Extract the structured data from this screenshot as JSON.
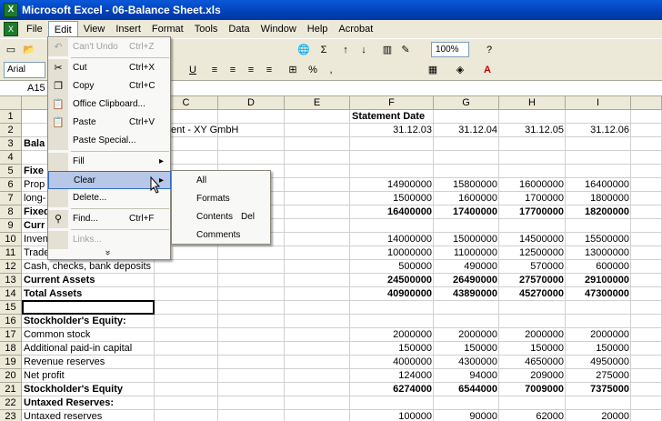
{
  "window": {
    "title": "Microsoft Excel - 06-Balance Sheet.xls",
    "app_icon": "X"
  },
  "menubar": {
    "items": [
      "File",
      "Edit",
      "View",
      "Insert",
      "Format",
      "Tools",
      "Data",
      "Window",
      "Help",
      "Acrobat"
    ]
  },
  "toolbar": {
    "font_name": "Arial",
    "zoom": "100%"
  },
  "formula_bar": {
    "name_box": "A15"
  },
  "columns": [
    "",
    "",
    "C",
    "D",
    "E",
    "F",
    "G",
    "H",
    "I"
  ],
  "rows": [
    "1",
    "2",
    "3",
    "4",
    "5",
    "6",
    "7",
    "8",
    "9",
    "10",
    "11",
    "12",
    "13",
    "14",
    "15",
    "16",
    "17",
    "18",
    "19",
    "20",
    "21",
    "22",
    "23"
  ],
  "cells": {
    "f1": "Statement Date",
    "c2": "ent - XY GmbH",
    "r2": [
      "31.12.03",
      "31.12.04",
      "31.12.05",
      "31.12.06"
    ],
    "a3": "Bala",
    "a5": "Fixe",
    "a6": "Prop",
    "r6": [
      "14900000",
      "15800000",
      "16000000",
      "16400000"
    ],
    "a7": "long-",
    "r7": [
      "1500000",
      "1600000",
      "1700000",
      "1800000"
    ],
    "a8": "Fixed",
    "r8": [
      "16400000",
      "17400000",
      "17700000",
      "18200000"
    ],
    "a9": "Curr",
    "a10": "Inven",
    "r10": [
      "14000000",
      "15000000",
      "14500000",
      "15500000"
    ],
    "a11": "Trade",
    "r11": [
      "10000000",
      "11000000",
      "12500000",
      "13000000"
    ],
    "a12": "Cash, checks, bank deposits",
    "r12": [
      "500000",
      "490000",
      "570000",
      "600000"
    ],
    "a13": "Current Assets",
    "r13": [
      "24500000",
      "26490000",
      "27570000",
      "29100000"
    ],
    "a14": "Total Assets",
    "r14": [
      "40900000",
      "43890000",
      "45270000",
      "47300000"
    ],
    "a16": "Stockholder's Equity:",
    "a17": "Common stock",
    "r17": [
      "2000000",
      "2000000",
      "2000000",
      "2000000"
    ],
    "a18": "Additional paid-in capital",
    "r18": [
      "150000",
      "150000",
      "150000",
      "150000"
    ],
    "a19": "Revenue reserves",
    "r19": [
      "4000000",
      "4300000",
      "4650000",
      "4950000"
    ],
    "a20": "Net profit",
    "r20": [
      "124000",
      "94000",
      "209000",
      "275000"
    ],
    "a21": "Stockholder's Equity",
    "r21": [
      "6274000",
      "6544000",
      "7009000",
      "7375000"
    ],
    "a22": "Untaxed Reserves:",
    "a23": "Untaxed reserves",
    "r23": [
      "100000",
      "90000",
      "62000",
      "20000"
    ]
  },
  "edit_menu": {
    "undo": {
      "label": "Can't Undo",
      "shortcut": "Ctrl+Z"
    },
    "cut": {
      "label": "Cut",
      "shortcut": "Ctrl+X"
    },
    "copy": {
      "label": "Copy",
      "shortcut": "Ctrl+C"
    },
    "clipboard": {
      "label": "Office Clipboard..."
    },
    "paste": {
      "label": "Paste",
      "shortcut": "Ctrl+V"
    },
    "paste_special": {
      "label": "Paste Special..."
    },
    "fill": {
      "label": "Fill"
    },
    "clear": {
      "label": "Clear"
    },
    "delete": {
      "label": "Delete..."
    },
    "find": {
      "label": "Find...",
      "shortcut": "Ctrl+F"
    },
    "links": {
      "label": "Links..."
    },
    "expand": {
      "label": "»"
    }
  },
  "clear_submenu": {
    "all": "All",
    "formats": "Formats",
    "contents": {
      "label": "Contents",
      "shortcut": "Del"
    },
    "comments": "Comments"
  },
  "colors": {
    "title_bar": "#0a58d8",
    "highlight": "#b6c7e8",
    "menu_bg": "#ece9d8"
  }
}
